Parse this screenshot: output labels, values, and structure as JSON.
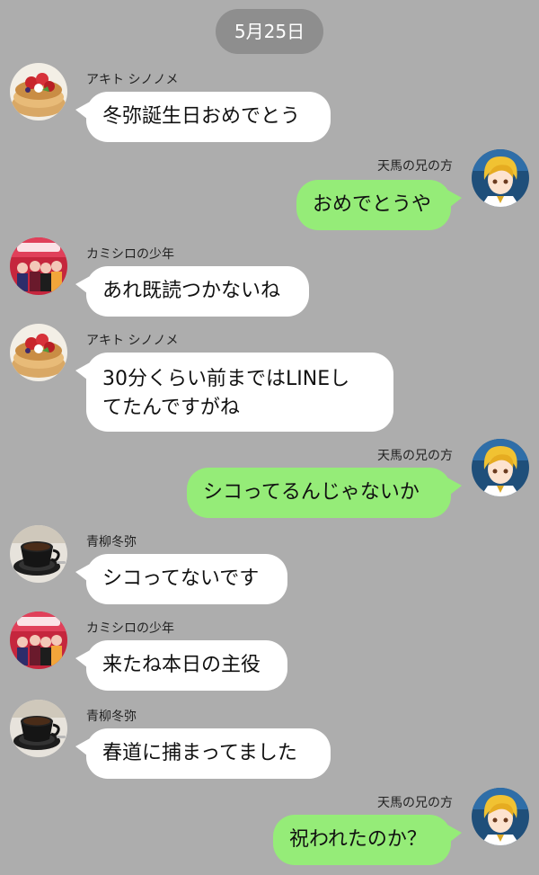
{
  "chat": {
    "date": "5月25日",
    "messages": [
      {
        "sender": "アキト シノノメ",
        "text": "冬弥誕生日おめでとう",
        "side": "left",
        "avatar": "pancake-avatar-icon"
      },
      {
        "sender": "天馬の兄の方",
        "text": "おめでとうや",
        "side": "right",
        "avatar": "blonde-character-avatar-icon"
      },
      {
        "sender": "カミシロの少年",
        "text": "あれ既読つかないね",
        "side": "left",
        "avatar": "group-photo-avatar-icon"
      },
      {
        "sender": "アキト シノノメ",
        "text": "30分くらい前まではLINEしてたんですがね",
        "line1": "30分くらい前まではLINEし",
        "line2": "てたんですがね",
        "side": "left",
        "avatar": "pancake-avatar-icon"
      },
      {
        "sender": "天馬の兄の方",
        "text": "シコってるんじゃないか",
        "side": "right",
        "avatar": "blonde-character-avatar-icon"
      },
      {
        "sender": "青柳冬弥",
        "text": "シコってないです",
        "side": "left",
        "avatar": "coffee-cup-avatar-icon"
      },
      {
        "sender": "カミシロの少年",
        "text": "来たね本日の主役",
        "side": "left",
        "avatar": "group-photo-avatar-icon"
      },
      {
        "sender": "青柳冬弥",
        "text": "春道に捕まってました",
        "side": "left",
        "avatar": "coffee-cup-avatar-icon"
      },
      {
        "sender": "天馬の兄の方",
        "text": "祝われたのか？",
        "side": "right",
        "avatar": "blonde-character-avatar-icon"
      }
    ]
  },
  "colors": {
    "background": "#adadad",
    "bubble_in": "#ffffff",
    "bubble_out": "#95ec78",
    "date_pill": "#8e8e8e"
  }
}
